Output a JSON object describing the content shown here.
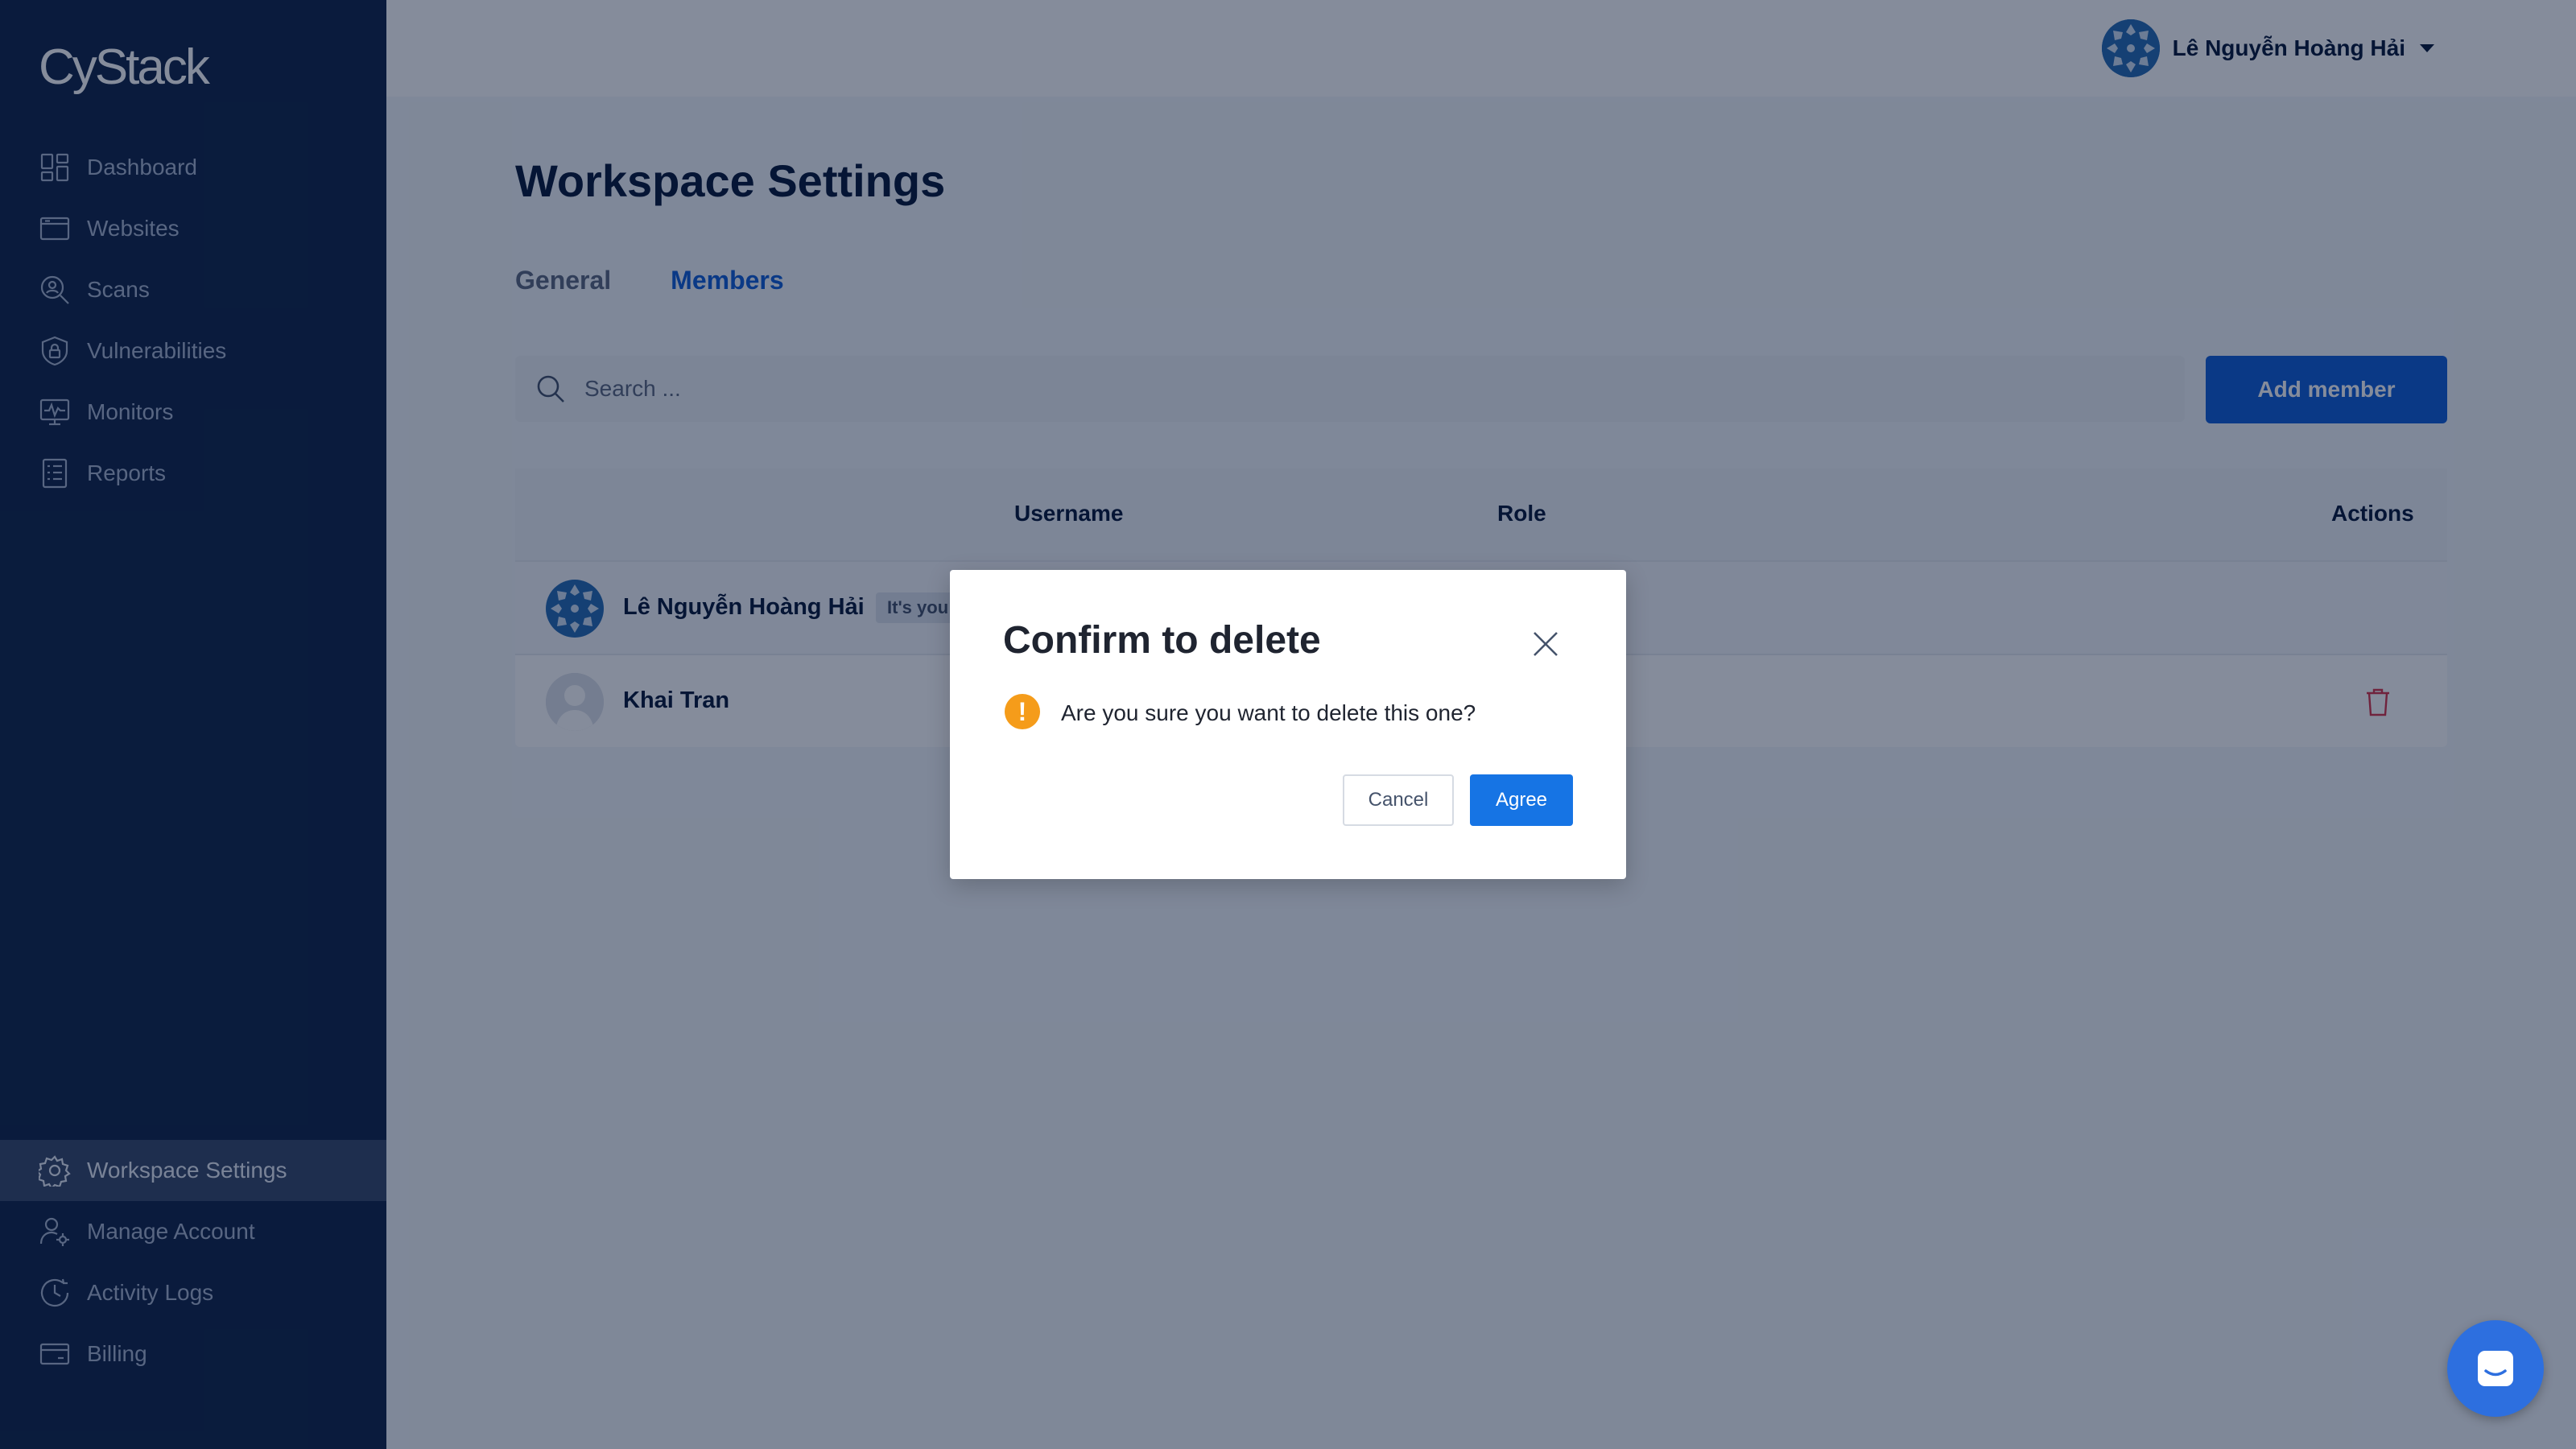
{
  "app": {
    "logo": "CyStack"
  },
  "sidebar": {
    "top_items": [
      {
        "label": "Dashboard",
        "icon": "dashboard-icon"
      },
      {
        "label": "Websites",
        "icon": "browser-window-icon"
      },
      {
        "label": "Scans",
        "icon": "scan-icon"
      },
      {
        "label": "Vulnerabilities",
        "icon": "shield-lock-icon"
      },
      {
        "label": "Monitors",
        "icon": "monitor-pulse-icon"
      },
      {
        "label": "Reports",
        "icon": "report-list-icon"
      }
    ],
    "bottom_items": [
      {
        "label": "Workspace Settings",
        "icon": "gear-icon",
        "active": true
      },
      {
        "label": "Manage Account",
        "icon": "user-gear-icon"
      },
      {
        "label": "Activity Logs",
        "icon": "clock-icon"
      },
      {
        "label": "Billing",
        "icon": "credit-card-icon"
      }
    ]
  },
  "header": {
    "user_name": "Lê Nguyễn Hoàng Hải"
  },
  "page": {
    "title": "Workspace Settings",
    "tabs": [
      {
        "label": "General",
        "active": false
      },
      {
        "label": "Members",
        "active": true
      }
    ],
    "search": {
      "placeholder": "Search ...",
      "value": ""
    },
    "add_member_label": "Add member"
  },
  "table": {
    "columns": [
      "Username",
      "Role",
      "Actions"
    ],
    "rows": [
      {
        "name": "Lê Nguyễn Hoàng Hải",
        "badge": "It's you",
        "avatar": "pattern-avatar",
        "deletable": false
      },
      {
        "name": "Khai Tran",
        "avatar": "default-avatar",
        "deletable": true
      }
    ]
  },
  "modal": {
    "title": "Confirm to delete",
    "message": "Are you sure you want to delete this one?",
    "warning_symbol": "!",
    "cancel_label": "Cancel",
    "agree_label": "Agree"
  },
  "colors": {
    "sidebar_bg": "#14284b",
    "primary": "#1560d6",
    "agree": "#1674e4",
    "warning": "#f59c1a",
    "danger": "#d6364b"
  }
}
